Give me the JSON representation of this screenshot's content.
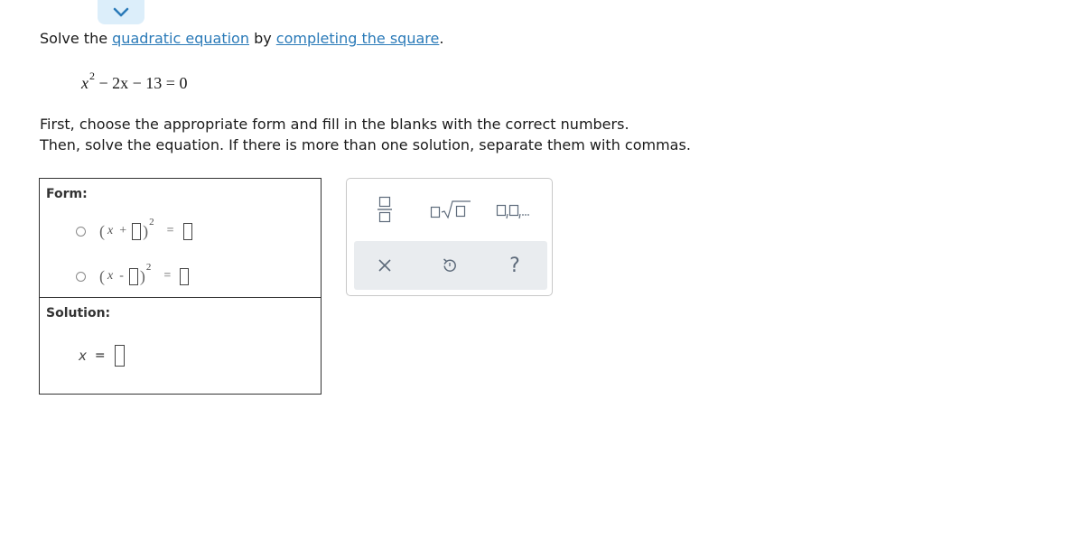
{
  "prompt": {
    "text_before": "Solve the ",
    "link1": "quadratic equation",
    "text_middle": " by ",
    "link2": "completing the square",
    "text_after": "."
  },
  "equation": {
    "var": "x",
    "exponent": "2",
    "rest": " − 2x − 13 = 0"
  },
  "instructions": {
    "line1": "First, choose the appropriate form and fill in the blanks with the correct numbers.",
    "line2": "Then, solve the equation. If there is more than one solution, separate them with commas."
  },
  "form": {
    "label": "Form:",
    "options": [
      {
        "open": "(",
        "var": "x",
        "op": "+",
        "close": ")",
        "exp": "2",
        "eq": "="
      },
      {
        "open": "(",
        "var": "x",
        "op": "-",
        "close": ")",
        "exp": "2",
        "eq": "="
      }
    ]
  },
  "solution": {
    "label": "Solution:",
    "var": "x",
    "eq": "="
  },
  "toolbar": {
    "help": "?"
  },
  "colors": {
    "link": "#2a7ab8",
    "tab": "#dceefa",
    "action_bar": "#e9ecef",
    "icon": "#5d6a7a"
  }
}
